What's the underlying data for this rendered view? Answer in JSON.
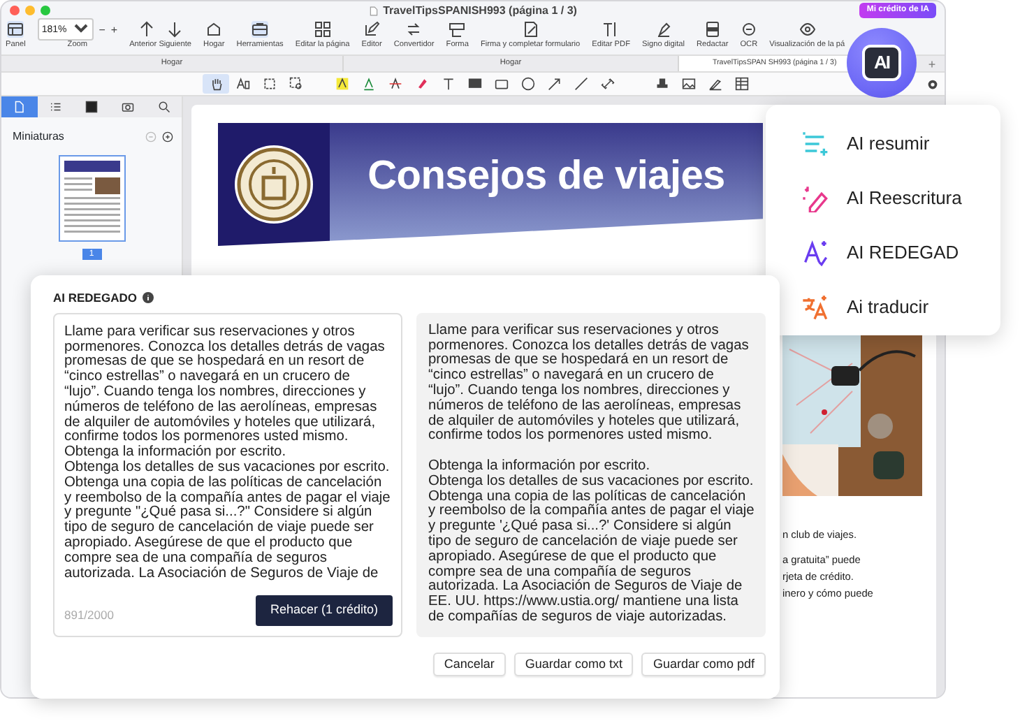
{
  "window": {
    "title": "TravelTipsSPANISH993 (página 1 / 3)"
  },
  "credit_button": {
    "label": "Mi crédito de IA"
  },
  "toolbar": {
    "items": [
      {
        "label": "Panel",
        "active": true
      },
      {
        "label": "Zoom",
        "kind": "zoom",
        "value": "181%",
        "minus": "−",
        "plus": "+"
      },
      {
        "label": "Anterior Siguiente",
        "kind": "pair",
        "active": false
      },
      {
        "label": "Hogar",
        "active": false
      },
      {
        "label": "Herramientas",
        "active": true
      },
      {
        "label": "Editar la página",
        "active": false
      },
      {
        "label": "Editor",
        "active": false
      },
      {
        "label": "Convertidor",
        "active": false
      },
      {
        "label": "Forma",
        "active": false
      },
      {
        "label": "Firma y completar formulario",
        "active": false
      },
      {
        "label": "Editar PDF",
        "active": false
      },
      {
        "label": "Signo digital",
        "active": false
      },
      {
        "label": "Redactar",
        "active": false
      },
      {
        "label": "OCR",
        "active": false
      },
      {
        "label": "Visualización de la pá",
        "active": false
      }
    ]
  },
  "tabs": [
    {
      "label": "Hogar",
      "selected": false
    },
    {
      "label": "Hogar",
      "selected": false
    },
    {
      "label": "TravelTipsSPAN SH993 (página 1 / 3)",
      "selected": true
    }
  ],
  "new_tab": "+",
  "tools": [
    {
      "selected": true
    },
    {
      "selected": false
    },
    {
      "selected": false
    },
    {
      "selected": false
    },
    {
      "selected": false
    },
    {
      "selected": false
    },
    {
      "selected": false
    },
    {
      "selected": false
    },
    {
      "selected": false
    },
    {
      "selected": false
    },
    {
      "selected": false
    },
    {
      "selected": false
    },
    {
      "selected": false
    },
    {
      "selected": false
    },
    {
      "selected": false
    },
    {
      "selected": false
    },
    {
      "selected": false
    },
    {
      "selected": false
    },
    {
      "selected": false
    }
  ],
  "sidebar": {
    "tabs": [
      {
        "selected": true
      },
      {
        "selected": false
      },
      {
        "selected": false
      },
      {
        "selected": false
      },
      {
        "selected": false
      }
    ],
    "title": "Miniaturas",
    "pages": [
      {
        "label": "1",
        "selected": true
      }
    ]
  },
  "document": {
    "banner_title": "Consejos de viajes",
    "text_lines": [
      "n club de viajes.",
      "a gratuita” puede",
      "rjeta de crédito.",
      "inero y cómo puede"
    ]
  },
  "ai_button": {
    "label": "AI"
  },
  "ai_menu": {
    "items": [
      {
        "label": "AI resumir",
        "color": "#3cc8d8"
      },
      {
        "label": "AI Reescritura",
        "color": "#e8388c"
      },
      {
        "label": "AI REDEGAD",
        "color": "#6a3cf0"
      },
      {
        "label": "Ai traducir",
        "color": "#f07030"
      }
    ]
  },
  "dialog": {
    "title": "AI REDEGADO",
    "original_text": "Llame para verificar sus reservaciones y otros\npormenores. Conozca los detalles detrás de vagas\npromesas de que se hospedará en un resort de\n“cinco estrellas” o navegará en un crucero de\n“lujo”. Cuando tenga los nombres, direcciones y\nnúmeros de teléfono de las aerolíneas, empresas\nde alquiler de automóviles y hoteles que utilizará,\nconfirme todos los pormenores usted mismo.\nObtenga la información por escrito.\nObtenga los detalles de sus vacaciones por escrito.\nObtenga una copia de las políticas de cancelación\ny reembolso de la compañía antes de pagar el viaje\ny pregunte \"¿Qué pasa si...?\" Considere si algún\ntipo de seguro de cancelación de viaje puede ser\napropiado. Asegúrese de que el producto que\ncompre sea de una compañía de seguros\nautorizada. La Asociación de Seguros de Viaje de",
    "counter": "891/2000",
    "redo_button": "Rehacer (1 crédito)",
    "result_text": "Llame para verificar sus reservaciones y otros\npormenores. Conozca los detalles detrás de vagas\npromesas de que se hospedará en un resort de\n“cinco estrellas” o navegará en un crucero de\n“lujo”. Cuando tenga los nombres, direcciones y\nnúmeros de teléfono de las aerolíneas, empresas\nde alquiler de automóviles y hoteles que utilizará,\nconfirme todos los pormenores usted mismo.\n\nObtenga la información por escrito.\nObtenga los detalles de sus vacaciones por escrito.\nObtenga una copia de las políticas de cancelación\ny reembolso de la compañía antes de pagar el viaje\ny pregunte '¿Qué pasa si...?' Considere si algún\ntipo de seguro de cancelación de viaje puede ser\napropiado. Asegúrese de que el producto que\ncompre sea de una compañía de seguros\nautorizada. La Asociación de Seguros de Viaje de\nEE. UU. https://www.ustia.org/ mantiene una lista\nde compañías de seguros de viaje autorizadas.",
    "buttons": [
      "Cancelar",
      "Guardar como txt",
      "Guardar como pdf"
    ]
  }
}
